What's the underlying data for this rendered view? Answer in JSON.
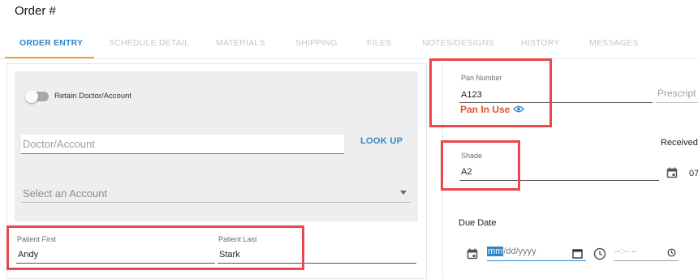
{
  "page": {
    "title": "Order #"
  },
  "tabs": [
    {
      "label": "ORDER ENTRY",
      "active": true
    },
    {
      "label": "SCHEDULE DETAIL"
    },
    {
      "label": "MATERIALS"
    },
    {
      "label": "SHIPPING"
    },
    {
      "label": "FILES"
    },
    {
      "label": "NOTES/DESIGNS"
    },
    {
      "label": "HISTORY"
    },
    {
      "label": "MESSAGES"
    }
  ],
  "form": {
    "retain_label": "Retain Doctor/Account",
    "doctor_placeholder": "Doctor/Account",
    "lookup_label": "LOOK UP",
    "account_placeholder": "Select an Account",
    "patient_first": {
      "label": "Patient First",
      "value": "Andy"
    },
    "patient_last": {
      "label": "Patient Last",
      "value": "Stark"
    }
  },
  "right": {
    "pan_number": {
      "label": "Pan Number",
      "value": "A123"
    },
    "pan_status": "Pan In Use",
    "prescript_label": "Prescript",
    "shade": {
      "label": "Shade",
      "value": "A2"
    },
    "received_label": "Received",
    "received_value": "07",
    "due_date_label": "Due Date",
    "date_segments": {
      "mm": "mm",
      "rest": "/dd/yyyy"
    },
    "time_placeholder": "--:-- --"
  },
  "colors": {
    "accent": "#2f86c9",
    "tab_indicator": "#f0a23a",
    "warning": "#e0542b",
    "highlight": "#e8474b"
  }
}
